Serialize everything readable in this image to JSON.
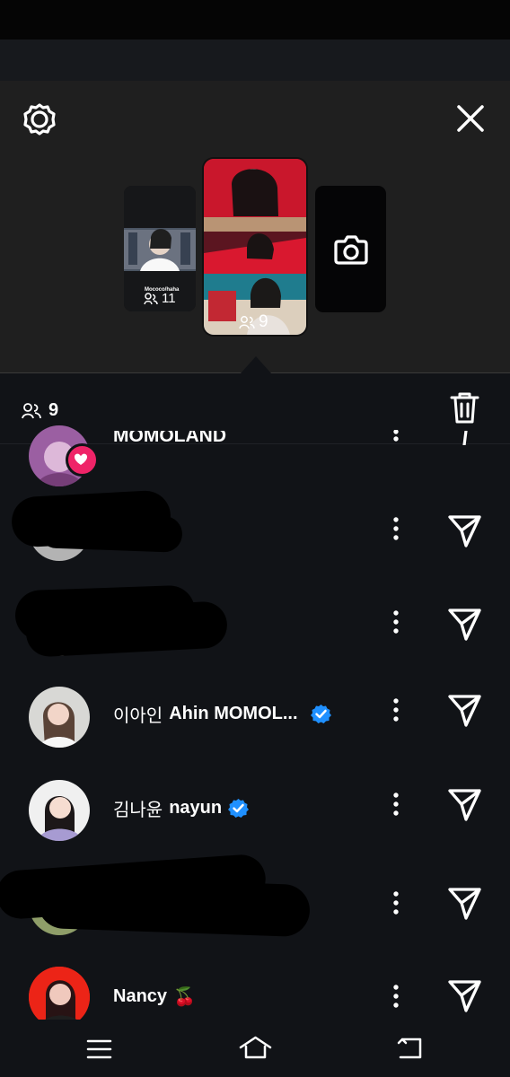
{
  "story_viewers": {
    "left_story_count": "11",
    "center_story_count": "9",
    "left_story_caption": "Mococo/haha"
  },
  "list_header": {
    "viewer_count": "9"
  },
  "contacts": [
    {
      "id": "partial-top",
      "name_prefix": "MOMOLAND"
    },
    {
      "id": "redacted-1"
    },
    {
      "id": "redacted-2"
    },
    {
      "id": "ahin",
      "name_korean": "이아인",
      "name_latin": "Ahin MOMOL...",
      "verified": true
    },
    {
      "id": "nayun",
      "name_korean": "김나윤",
      "name_latin": "nayun",
      "verified": true
    },
    {
      "id": "redacted-3"
    },
    {
      "id": "nancy",
      "name_latin": "Nancy",
      "emoji": "🍒"
    }
  ],
  "icons": {
    "settings": "settings-gear-icon",
    "close": "close-x-icon",
    "camera": "camera-icon",
    "viewers": "people-icon",
    "trash": "trash-icon",
    "more": "kebab-menu-icon",
    "send": "send-paper-plane-icon"
  }
}
